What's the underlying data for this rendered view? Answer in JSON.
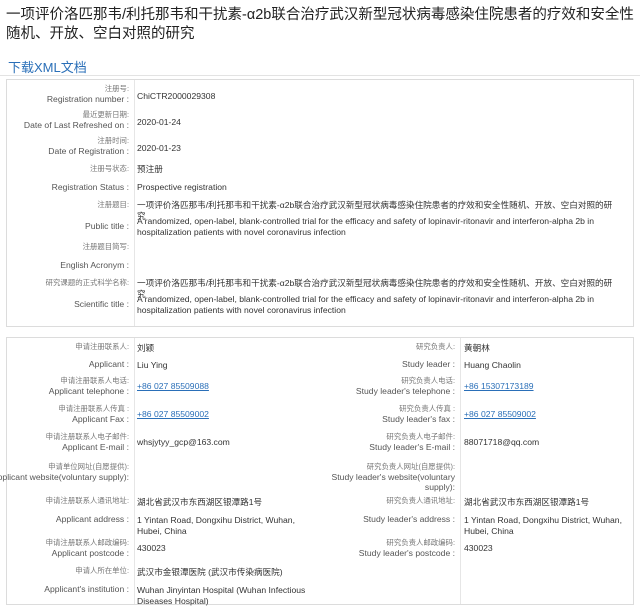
{
  "header": {
    "title": "一项评价洛匹那韦/利托那韦和干扰素-α2b联合治疗武汉新型冠状病毒感染住院患者的疗效和安全性随机、开放、空白对照的研究",
    "download_label": "下载XML文档"
  },
  "registration": [
    {
      "cn": "注册号:",
      "en": "Registration number :",
      "value": "ChiCTR2000029308"
    },
    {
      "cn": "最近更新日期:",
      "en": "Date of Last Refreshed on :",
      "value": "2020-01-24"
    },
    {
      "cn": "注册时间:",
      "en": "Date of Registration :",
      "value": "2020-01-23"
    },
    {
      "cn": "注册号状态:",
      "en": "",
      "value": "预注册"
    },
    {
      "cn": "",
      "en": "Registration Status :",
      "value": "Prospective registration"
    },
    {
      "cn": "注册题目:",
      "en": "",
      "value": "一项评价洛匹那韦/利托那韦和干扰素-α2b联合治疗武汉新型冠状病毒感染住院患者的疗效和安全性随机、开放、空白对照的研究"
    },
    {
      "cn": "",
      "en": "Public title :",
      "value": "A randomized, open-label, blank-controlled trial for the efficacy and safety of lopinavir-ritonavir and interferon-alpha 2b in hospitalization patients with novel coronavirus infection"
    },
    {
      "cn": "注册题目简写:",
      "en": "",
      "value": ""
    },
    {
      "cn": "",
      "en": "English Acronym :",
      "value": ""
    },
    {
      "cn": "研究课题的正式科学名称:",
      "en": "",
      "value": "一项评价洛匹那韦/利托那韦和干扰素-α2b联合治疗武汉新型冠状病毒感染住院患者的疗效和安全性随机、开放、空白对照的研究"
    },
    {
      "cn": "",
      "en": "Scientific title :",
      "value": "A randomized, open-label, blank-controlled trial for the efficacy and safety of lopinavir-ritonavir and interferon-alpha 2b in hospitalization patients with novel coronavirus infection"
    }
  ],
  "contacts": [
    {
      "l_cn": "申请注册联系人:",
      "l_en": "",
      "l_val": "刘颖",
      "r_cn": "研究负责人:",
      "r_en": "",
      "r_val": "黄朝林"
    },
    {
      "l_cn": "",
      "l_en": "Applicant :",
      "l_val": "Liu Ying",
      "r_cn": "",
      "r_en": "Study leader :",
      "r_val": "Huang Chaolin"
    },
    {
      "l_cn": "申请注册联系人电话:",
      "l_en": "Applicant telephone :",
      "l_val": "+86 027 85509088",
      "r_cn": "研究负责人电话:",
      "r_en": "Study leader's telephone :",
      "r_val": "+86 15307173189"
    },
    {
      "l_cn": "申请注册联系人传真 :",
      "l_en": "Applicant Fax :",
      "l_val": "+86 027 85509002",
      "r_cn": "研究负责人传真 :",
      "r_en": "Study leader's fax :",
      "r_val": "+86 027 85509002"
    },
    {
      "l_cn": "申请注册联系人电子邮件:",
      "l_en": "Applicant E-mail :",
      "l_val": "whsjytyy_gcp@163.com",
      "r_cn": "研究负责人电子邮件:",
      "r_en": "Study leader's E-mail :",
      "r_val": "88071718@qq.com"
    },
    {
      "l_cn": "申请单位网址(自愿提供):",
      "l_en": "Applicant website(voluntary supply):",
      "l_val": "",
      "r_cn": "研究负责人网址(自愿提供):",
      "r_en": "Study leader's website(voluntary supply):",
      "r_val": ""
    },
    {
      "l_cn": "申请注册联系人通讯地址:",
      "l_en": "",
      "l_val": "湖北省武汉市东西湖区银潭路1号",
      "r_cn": "研究负责人通讯地址:",
      "r_en": "",
      "r_val": "湖北省武汉市东西湖区银潭路1号"
    },
    {
      "l_cn": "",
      "l_en": "Applicant address :",
      "l_val": "1 Yintan Road, Dongxihu District, Wuhan, Hubei, China",
      "r_cn": "",
      "r_en": "Study leader's address :",
      "r_val": "1 Yintan Road, Dongxihu District, Wuhan, Hubei, China"
    },
    {
      "l_cn": "申请注册联系人邮政编码:",
      "l_en": "Applicant postcode :",
      "l_val": "430023",
      "r_cn": "研究负责人邮政编码:",
      "r_en": "Study leader's postcode :",
      "r_val": "430023"
    },
    {
      "l_cn": "申请人所在单位:",
      "l_en": "",
      "l_val": "武汉市金银潭医院 (武汉市传染病医院)",
      "r_cn": "",
      "r_en": "",
      "r_val": ""
    },
    {
      "l_cn": "",
      "l_en": "Applicant's institution :",
      "l_val": "Wuhan Jinyintan Hospital (Wuhan Infectious Diseases Hospital)",
      "r_cn": "",
      "r_en": "",
      "r_val": ""
    }
  ]
}
